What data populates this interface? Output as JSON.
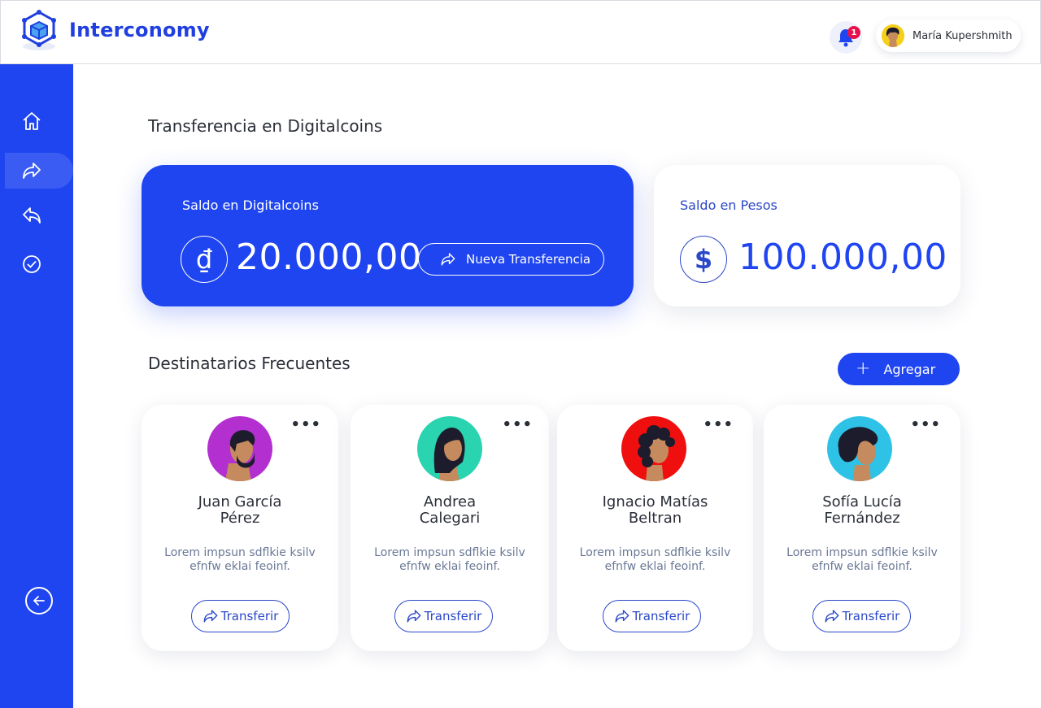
{
  "header": {
    "brand": "Interconomy",
    "notification_count": "1",
    "user_name": "María Kupershmith"
  },
  "sidebar": {
    "items": [
      {
        "name": "home",
        "icon": "home-icon",
        "active": false
      },
      {
        "name": "transfer",
        "icon": "share-forward-icon",
        "active": true
      },
      {
        "name": "reply",
        "icon": "reply-icon",
        "active": false
      },
      {
        "name": "check",
        "icon": "check-circle-icon",
        "active": false
      }
    ],
    "bottom_icon": "arrow-left-circle-icon"
  },
  "main": {
    "title": "Transferencia en Digitalcoins",
    "digital_balance": {
      "label": "Saldo en Digitalcoins",
      "currency_symbol": "₫",
      "amount": "20.000,00",
      "button_label": "Nueva Transferencia"
    },
    "peso_balance": {
      "label": "Saldo en Pesos",
      "currency_symbol": "$",
      "amount": "100.000,00"
    },
    "recipients_title": "Destinatarios Frecuentes",
    "add_button_label": "Agregar",
    "recipients": [
      {
        "name_line1": "Juan García",
        "name_line2": "Pérez",
        "desc_line1": "Lorem impsun sdflkie ksilv",
        "desc_line2": "efnfw eklai feoinf.",
        "button": "Transferir",
        "avatar_color": "#b32fd0"
      },
      {
        "name_line1": "Andrea",
        "name_line2": "Calegari",
        "desc_line1": "Lorem impsun sdflkie ksilv",
        "desc_line2": "efnfw eklai feoinf.",
        "button": "Transferir",
        "avatar_color": "#2ad4b0"
      },
      {
        "name_line1": "Ignacio Matías",
        "name_line2": "Beltran",
        "desc_line1": "Lorem impsun sdflkie ksilv",
        "desc_line2": "efnfw eklai feoinf.",
        "button": "Transferir",
        "avatar_color": "#f00f0f"
      },
      {
        "name_line1": "Sofía Lucía",
        "name_line2": "Fernández",
        "desc_line1": "Lorem impsun sdflkie ksilv",
        "desc_line2": "efnfw eklai feoinf.",
        "button": "Transferir",
        "avatar_color": "#2ec2e6"
      }
    ]
  },
  "colors": {
    "primary": "#1f45f0",
    "brand_text": "#1f3fe0",
    "badge": "#e8114b"
  }
}
